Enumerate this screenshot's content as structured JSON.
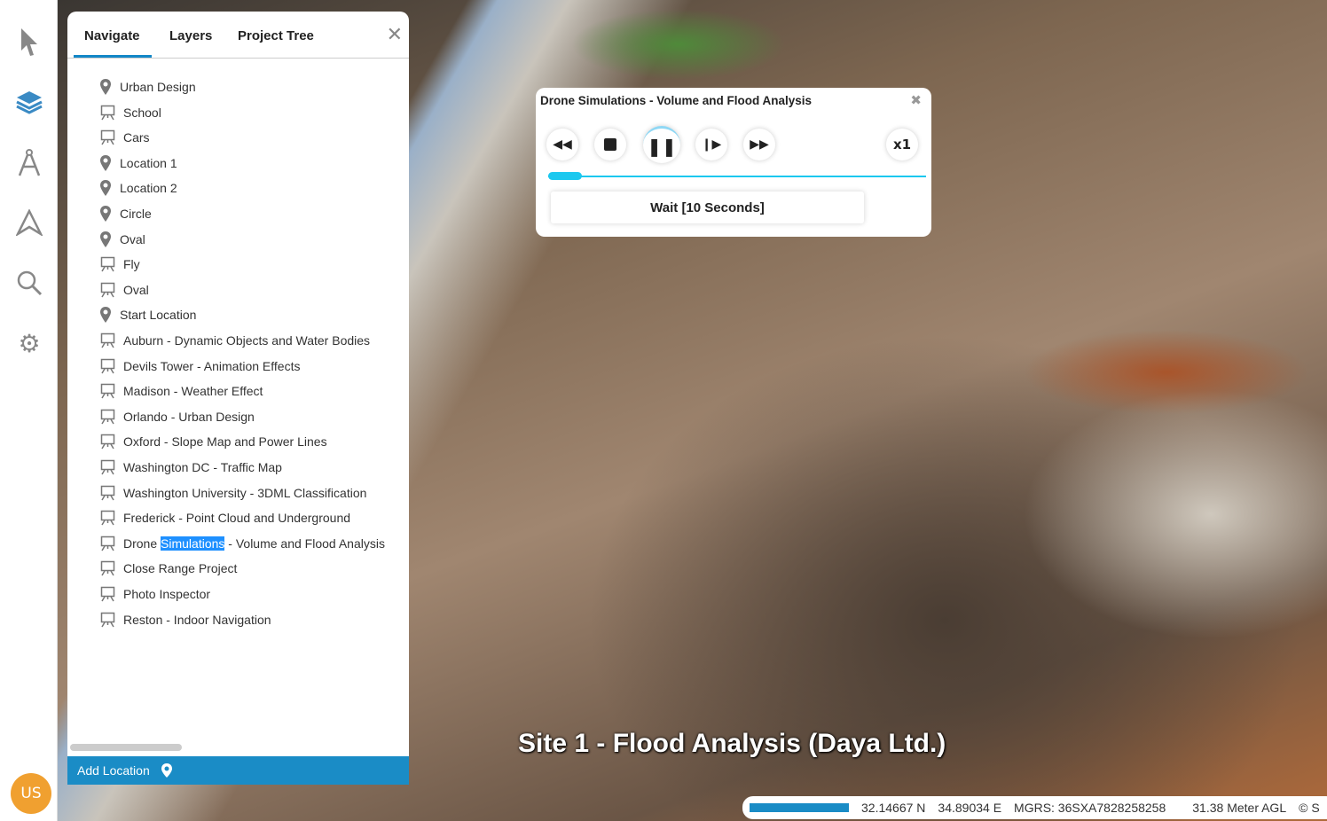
{
  "sidebar": {
    "icons": [
      "cursor-icon",
      "layers-icon",
      "compass-icon",
      "navigate-icon",
      "search-icon",
      "gear-icon"
    ],
    "avatar": "US"
  },
  "panel": {
    "tabs": [
      "Navigate",
      "Layers",
      "Project Tree"
    ],
    "active_tab": "Navigate",
    "items": [
      {
        "label": "Urban Design",
        "icon": "pin"
      },
      {
        "label": "School",
        "icon": "presentation"
      },
      {
        "label": "Cars",
        "icon": "presentation"
      },
      {
        "label": "Location 1",
        "icon": "pin"
      },
      {
        "label": "Location 2",
        "icon": "pin"
      },
      {
        "label": "Circle",
        "icon": "pin"
      },
      {
        "label": "Oval",
        "icon": "pin"
      },
      {
        "label": "Fly",
        "icon": "presentation"
      },
      {
        "label": "Oval",
        "icon": "presentation"
      },
      {
        "label": "Start Location",
        "icon": "pin"
      },
      {
        "label": "Auburn - Dynamic Objects and Water Bodies",
        "icon": "presentation"
      },
      {
        "label": "Devils Tower - Animation Effects",
        "icon": "presentation"
      },
      {
        "label": "Madison - Weather Effect",
        "icon": "presentation"
      },
      {
        "label": "Orlando - Urban Design",
        "icon": "presentation"
      },
      {
        "label": "Oxford - Slope Map and Power Lines",
        "icon": "presentation"
      },
      {
        "label": "Washington DC - Traffic Map",
        "icon": "presentation"
      },
      {
        "label": "Washington University - 3DML Classification",
        "icon": "presentation"
      },
      {
        "label": "Frederick - Point Cloud and Underground",
        "icon": "presentation"
      },
      {
        "label": "Drone Simulations - Volume and Flood Analysis",
        "icon": "presentation",
        "pre": "Drone ",
        "highlight": "Simulations",
        "post": " - Volume and Flood Analysis"
      },
      {
        "label": "Close Range Project",
        "icon": "presentation"
      },
      {
        "label": "Photo Inspector",
        "icon": "presentation"
      },
      {
        "label": "Reston - Indoor Navigation",
        "icon": "presentation"
      }
    ],
    "footer": "Add Location"
  },
  "player": {
    "title": "Drone Simulations - Volume and Flood Analysis",
    "speed": "x1",
    "progress_percent": 9,
    "status": "Wait [10 Seconds]"
  },
  "map": {
    "title": "Site 1 - Flood Analysis (Daya Ltd.)"
  },
  "statusbar": {
    "lat": "32.14667 N",
    "lon": "34.89034 E",
    "mgrs": "MGRS: 36SXA7828258258",
    "alt": "31.38 Meter AGL",
    "copyright": "© S"
  },
  "colors": {
    "accent": "#1a8cc6",
    "progress": "#1cc8ef",
    "avatar": "#f0a030"
  }
}
